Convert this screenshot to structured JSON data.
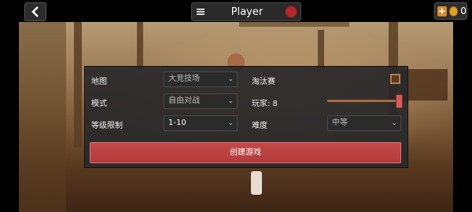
{
  "header": {
    "back_icon": "chevron-left-icon",
    "menu_icon": "hamburger-icon",
    "player_name": "Player",
    "coin_count": "0"
  },
  "settings": {
    "map_label": "地图",
    "map_value": "大竞技场",
    "mode_label": "模式",
    "mode_value": "自由对战",
    "level_label": "等级限制",
    "level_value": "1-10",
    "elimination_label": "淘汰赛",
    "elimination_checked": true,
    "players_label": "玩家: 8",
    "players_value": 8,
    "players_max": 8,
    "difficulty_label": "难度",
    "difficulty_value": "中等",
    "create_button": "创建游戏"
  },
  "colors": {
    "accent_red": "#c44a4a",
    "checkbox_orange": "#b57b4a"
  }
}
